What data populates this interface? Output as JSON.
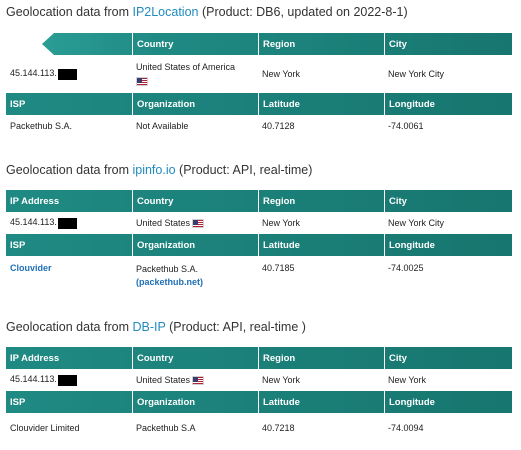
{
  "sections": [
    {
      "title_prefix": "Geolocation data from ",
      "provider": "IP2Location",
      "title_suffix": " (Product: DB6, updated on 2022-8-1)",
      "row1_headers": [
        "",
        "Country",
        "Region",
        "City"
      ],
      "row1_values": {
        "ip": "45.144.113.",
        "country": "United States of America",
        "region": "New York",
        "city": "New York City"
      },
      "row2_headers": [
        "ISP",
        "Organization",
        "Latitude",
        "Longitude"
      ],
      "row2_values": {
        "isp": "Packethub S.A.",
        "organization": "Not Available",
        "latitude": "40.7128",
        "longitude": "-74.0061"
      }
    },
    {
      "title_prefix": "Geolocation data from ",
      "provider": "ipinfo.io",
      "title_suffix": " (Product: API, real-time)",
      "row1_headers": [
        "IP Address",
        "Country",
        "Region",
        "City"
      ],
      "row1_values": {
        "ip": "45.144.113.",
        "country": "United States",
        "region": "New York",
        "city": "New York City"
      },
      "row2_headers": [
        "ISP",
        "Organization",
        "Latitude",
        "Longitude"
      ],
      "row2_values": {
        "isp": "Clouvider",
        "organization": "Packethub S.A.",
        "organization_link": "(packethub.net)",
        "latitude": "40.7185",
        "longitude": "-74.0025"
      }
    },
    {
      "title_prefix": "Geolocation data from ",
      "provider": "DB-IP",
      "title_suffix": " (Product: API, real-time )",
      "row1_headers": [
        "IP Address",
        "Country",
        "Region",
        "City"
      ],
      "row1_values": {
        "ip": "45.144.113.",
        "country": "United States",
        "region": "New York",
        "city": "New York"
      },
      "row2_headers": [
        "ISP",
        "Organization",
        "Latitude",
        "Longitude"
      ],
      "row2_values": {
        "isp": "Clouvider Limited",
        "organization": "Packethub S.A",
        "latitude": "40.7218",
        "longitude": "-74.0094"
      }
    }
  ],
  "icons": {
    "flag": "us-flag-icon"
  },
  "colors": {
    "header_bg": "#17766f",
    "link": "#1f8bbf",
    "isp_link": "#1f6fb6"
  }
}
